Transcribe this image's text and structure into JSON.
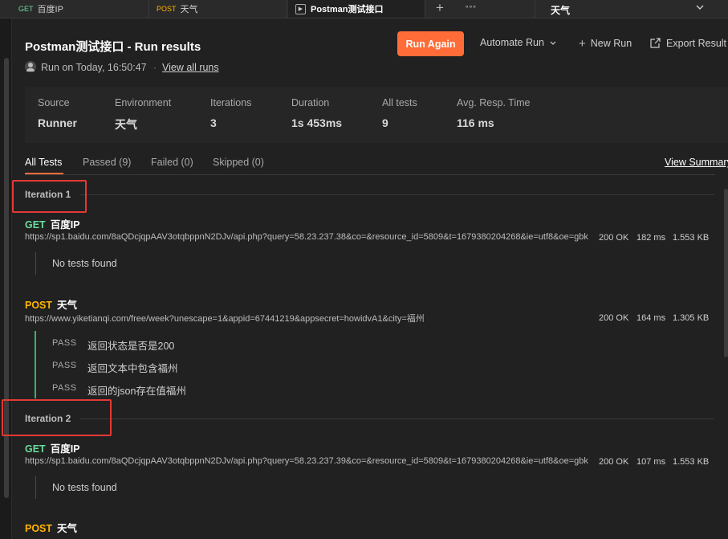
{
  "tabs": [
    {
      "method": "GET",
      "name": "百度IP"
    },
    {
      "method": "POST",
      "name": "天气"
    },
    {
      "name": "Postman测试接口"
    }
  ],
  "tab_add": "+",
  "tab_more": "∘∘∘",
  "env_select": {
    "value": "天气"
  },
  "header": {
    "title": "Postman测试接口 - Run results",
    "run_again": "Run Again",
    "automate_run": "Automate Run",
    "new_run": "New Run",
    "export_results": "Export Result",
    "run_on": "Run on Today, 16:50:47",
    "separator": "·",
    "view_all_runs": "View all runs"
  },
  "stats": [
    {
      "label": "Source",
      "value": "Runner"
    },
    {
      "label": "Environment",
      "value": "天气"
    },
    {
      "label": "Iterations",
      "value": "3"
    },
    {
      "label": "Duration",
      "value": "1s 453ms"
    },
    {
      "label": "All tests",
      "value": "9"
    },
    {
      "label": "Avg. Resp. Time",
      "value": "116 ms"
    }
  ],
  "filter_tabs": [
    "All Tests",
    "Passed (9)",
    "Failed (0)",
    "Skipped (0)"
  ],
  "view_summary": "View Summary",
  "iterations": [
    {
      "label": "Iteration 1",
      "requests": [
        {
          "method": "GET",
          "name": "百度IP",
          "url": "https://sp1.baidu.com/8aQDcjqpAAV3otqbppnN2DJv/api.php?query=58.23.237.38&co=&resource_id=5809&t=1679380204268&ie=utf8&oe=gbk",
          "status": "200 OK",
          "time": "182 ms",
          "size": "1.553 KB",
          "no_tests": "No tests found"
        },
        {
          "method": "POST",
          "name": "天气",
          "url": "https://www.yiketianqi.com/free/week?unescape=1&appid=67441219&appsecret=howidvA1&city=福州",
          "status": "200 OK",
          "time": "164 ms",
          "size": "1.305 KB",
          "tests": [
            {
              "result": "PASS",
              "name": "返回状态是否是200"
            },
            {
              "result": "PASS",
              "name": "返回文本中包含福州"
            },
            {
              "result": "PASS",
              "name": "返回的json存在值福州"
            }
          ]
        }
      ]
    },
    {
      "label": "Iteration 2",
      "requests": [
        {
          "method": "GET",
          "name": "百度IP",
          "url": "https://sp1.baidu.com/8aQDcjqpAAV3otqbppnN2DJv/api.php?query=58.23.237.39&co=&resource_id=5809&t=1679380204268&ie=utf8&oe=gbk",
          "status": "200 OK",
          "time": "107 ms",
          "size": "1.553 KB",
          "no_tests": "No tests found"
        },
        {
          "method": "POST",
          "name": "天气"
        }
      ]
    }
  ],
  "colors": {
    "accent": "#ff6c37",
    "get": "#6bdd9a",
    "post": "#ffb400",
    "pass_bar": "#36b36b",
    "highlight": "#e53935"
  }
}
